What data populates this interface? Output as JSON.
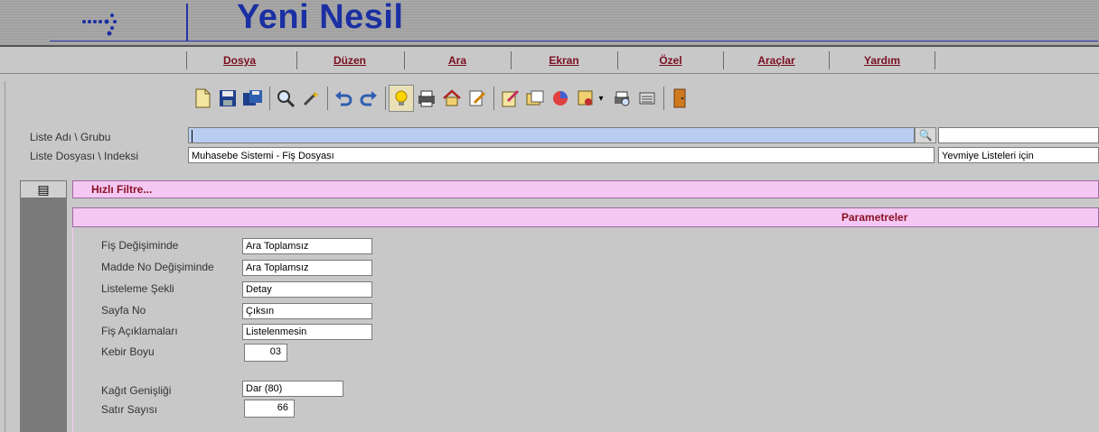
{
  "app": {
    "title": "Yeni Nesil"
  },
  "menu": {
    "items": [
      "Dosya",
      "Düzen",
      "Ara",
      "Ekran",
      "Özel",
      "Araçlar",
      "Yardım"
    ]
  },
  "toolbar": {
    "icons": [
      "new-document-icon",
      "save-icon",
      "save-all-icon",
      "search-icon",
      "magic-wand-icon",
      "undo-icon",
      "redo-icon",
      "light-bulb-icon",
      "printer-icon",
      "home-icon",
      "edit-icon",
      "notes-icon",
      "folders-icon",
      "chart-icon",
      "report-icon",
      "dropdown-arrow-icon",
      "print-preview-icon",
      "list-icon",
      "exit-icon"
    ]
  },
  "form": {
    "list_name_label": "Liste Adı \\ Grubu",
    "list_name_value": "",
    "list_file_label": "Liste Dosyası \\ Indeksi",
    "list_file_value": "Muhasebe Sistemi - Fiş Dosyası",
    "list_index_value": "Yevmiye Listeleri için"
  },
  "filter": {
    "title": "Hızlı Filtre...",
    "params_title": "Parametreler"
  },
  "params": {
    "fis_degisiminde": {
      "label": "Fiş Değişiminde",
      "value": "Ara Toplamsız"
    },
    "madde_no": {
      "label": "Madde No Değişiminde",
      "value": "Ara Toplamsız"
    },
    "listeleme_sekli": {
      "label": "Listeleme Şekli",
      "value": "Detay"
    },
    "sayfa_no": {
      "label": "Sayfa No",
      "value": "Çıksın"
    },
    "fis_aciklamalari": {
      "label": "Fiş Açıklamaları",
      "value": "Listelenmesin"
    },
    "kebir_boyu": {
      "label": "Kebir Boyu",
      "value": "03"
    },
    "kagit_genisligi": {
      "label": "Kağıt Genişliği",
      "value": "Dar (80)"
    },
    "satir_sayisi": {
      "label": "Satır Sayısı",
      "value": "66"
    }
  },
  "colors": {
    "title_blue": "#1b2fa3",
    "menu_text": "#7a1020",
    "filter_bar": "#f5c8f3",
    "active_field": "#b9cdf0"
  }
}
